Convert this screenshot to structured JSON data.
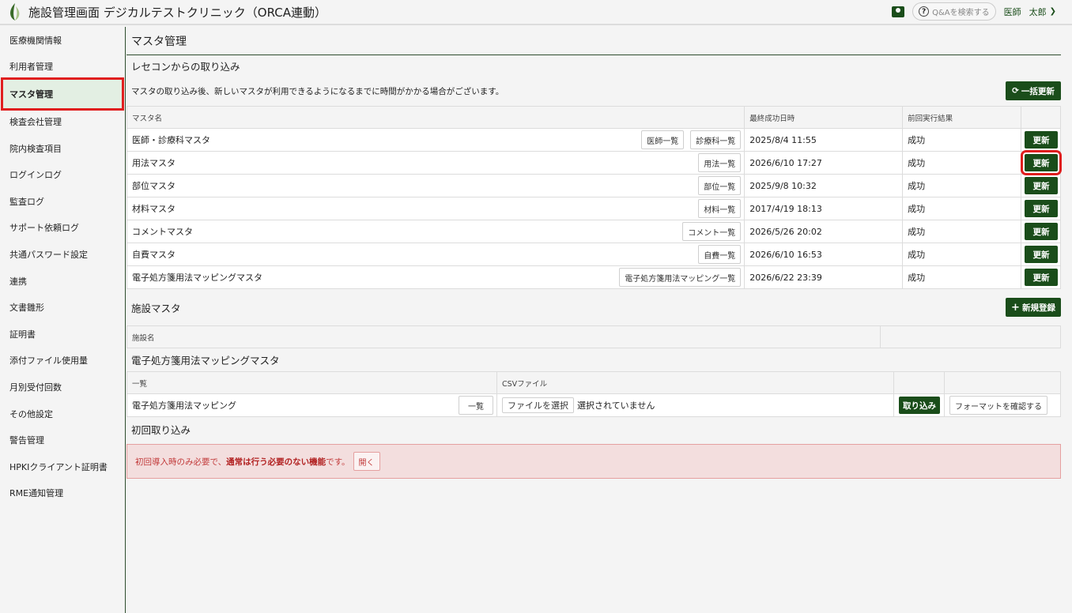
{
  "header": {
    "title": "施設管理画面 デジカルテストクリニック（ORCA連動）",
    "qa_search": "Q&Aを検索する",
    "user_role": "医師",
    "user_name": "太郎"
  },
  "sidebar": {
    "items": [
      {
        "label": "医療機関情報"
      },
      {
        "label": "利用者管理"
      },
      {
        "label": "マスタ管理",
        "active": true
      },
      {
        "label": "検査会社管理"
      },
      {
        "label": "院内検査項目"
      },
      {
        "label": "ログインログ"
      },
      {
        "label": "監査ログ"
      },
      {
        "label": "サポート依頼ログ"
      },
      {
        "label": "共通パスワード設定"
      },
      {
        "label": "連携"
      },
      {
        "label": "文書雛形"
      },
      {
        "label": "証明書"
      },
      {
        "label": "添付ファイル使用量"
      },
      {
        "label": "月別受付回数"
      },
      {
        "label": "その他設定"
      },
      {
        "label": "警告管理"
      },
      {
        "label": "HPKIクライアント証明書"
      },
      {
        "label": "RME通知管理"
      }
    ]
  },
  "main": {
    "page_title": "マスタ管理",
    "receipt_section": {
      "heading": "レセコンからの取り込み",
      "note": "マスタの取り込み後、新しいマスタが利用できるようになるまでに時間がかかる場合がございます。",
      "bulk_update": "一括更新",
      "columns": [
        "マスタ名",
        "最終成功日時",
        "前回実行結果"
      ],
      "update_label": "更新",
      "rows": [
        {
          "name": "医師・診療科マスタ",
          "buttons": [
            "医師一覧",
            "診療科一覧"
          ],
          "date": "2025/8/4 11:55",
          "result": "成功"
        },
        {
          "name": "用法マスタ",
          "buttons": [
            "用法一覧"
          ],
          "date": "2026/6/10 17:27",
          "result": "成功",
          "highlight": true
        },
        {
          "name": "部位マスタ",
          "buttons": [
            "部位一覧"
          ],
          "date": "2025/9/8 10:32",
          "result": "成功"
        },
        {
          "name": "材料マスタ",
          "buttons": [
            "材料一覧"
          ],
          "date": "2017/4/19 18:13",
          "result": "成功"
        },
        {
          "name": "コメントマスタ",
          "buttons": [
            "コメント一覧"
          ],
          "date": "2026/5/26 20:02",
          "result": "成功"
        },
        {
          "name": "自費マスタ",
          "buttons": [
            "自費一覧"
          ],
          "date": "2026/6/10 16:53",
          "result": "成功"
        },
        {
          "name": "電子処方箋用法マッピングマスタ",
          "buttons": [
            "電子処方箋用法マッピング一覧"
          ],
          "date": "2026/6/22 23:39",
          "result": "成功"
        }
      ]
    },
    "facility_section": {
      "heading": "施設マスタ",
      "new_button": "新規登録",
      "column": "施設名"
    },
    "mapping_section": {
      "heading": "電子処方箋用法マッピングマスタ",
      "col_list": "一覧",
      "col_csv": "CSVファイル",
      "row_name": "電子処方箋用法マッピング",
      "list_button": "一覧",
      "file_button": "ファイルを選択",
      "file_status": "選択されていません",
      "import_button": "取り込み",
      "format_button": "フォーマットを確認する"
    },
    "initial_section": {
      "heading": "初回取り込み",
      "alert_pre": "初回導入時のみ必要で、",
      "alert_bold": "通常は行う必要のない機能",
      "alert_post": "です。",
      "open_button": "開く"
    }
  }
}
